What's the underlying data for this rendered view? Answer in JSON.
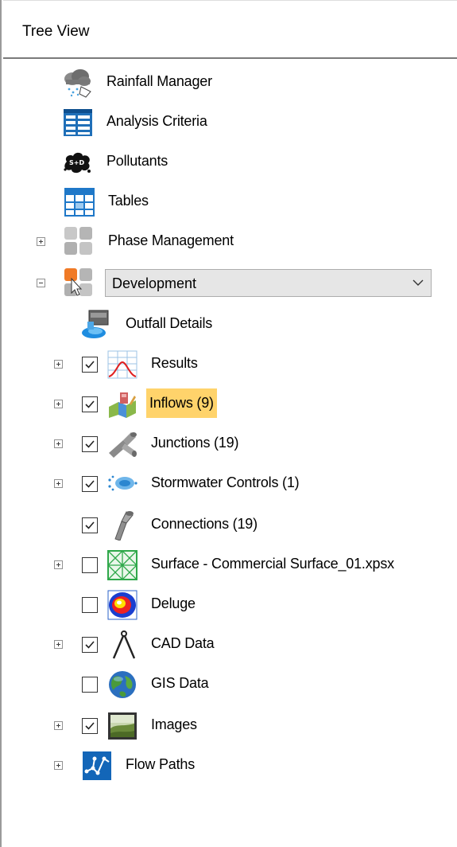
{
  "panel": {
    "title": "Tree View"
  },
  "tree": {
    "rainfall_manager": "Rainfall Manager",
    "analysis_criteria": "Analysis Criteria",
    "pollutants": "Pollutants",
    "tables": "Tables",
    "phase_management": "Phase Management",
    "phase_select": {
      "selected": "Development"
    },
    "outfall_details": "Outfall Details",
    "results": {
      "label": "Results",
      "checked": true
    },
    "inflows": {
      "label": "Inflows (9)",
      "checked": true,
      "highlight_color": "#ffd36b"
    },
    "junctions": {
      "label": "Junctions (19)",
      "checked": true
    },
    "stormwater_controls": {
      "label": "Stormwater Controls (1)",
      "checked": true
    },
    "connections": {
      "label": "Connections (19)",
      "checked": true
    },
    "surface": {
      "label": "Surface - Commercial Surface_01.xpsx",
      "checked": false
    },
    "deluge": {
      "label": "Deluge",
      "checked": false
    },
    "cad_data": {
      "label": "CAD Data",
      "checked": true
    },
    "gis_data": {
      "label": "GIS Data",
      "checked": false
    },
    "images": {
      "label": "Images",
      "checked": true
    },
    "flow_paths": "Flow Paths"
  }
}
